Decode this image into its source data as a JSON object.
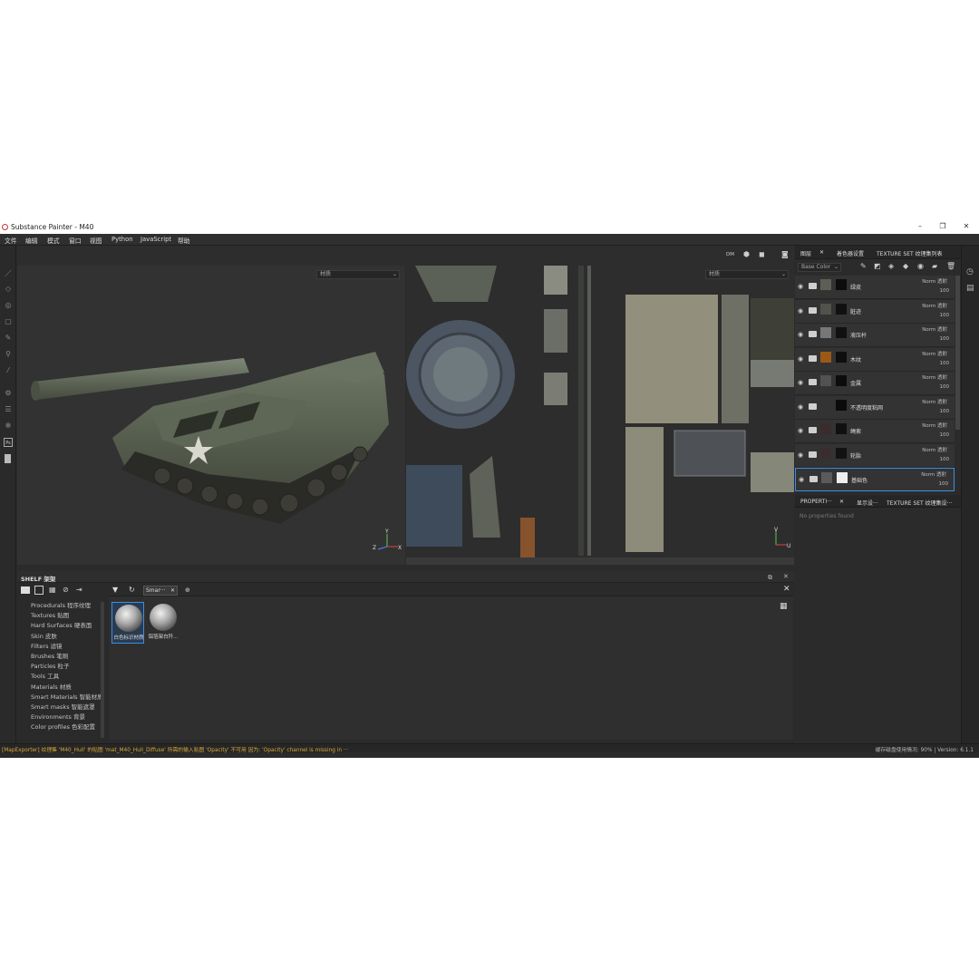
{
  "window": {
    "title": "Substance Painter - M40",
    "min": "–",
    "max": "❐",
    "close": "✕"
  },
  "menu": [
    "文件",
    "编辑",
    "模式",
    "窗口",
    "视图",
    "Python",
    "JavaScript",
    "帮助"
  ],
  "viewport": {
    "material_dropdown_3d": "材质",
    "material_dropdown_2d": "材质",
    "axis_3d": {
      "y": "Y",
      "z": "Z",
      "x": "X"
    },
    "axis_2d": {
      "v": "V",
      "u": "U"
    },
    "icons": [
      "dm-icon",
      "cube-icon",
      "camera-icon",
      "screenshot-icon"
    ],
    "dm_label": "DM"
  },
  "shelf": {
    "title": "SHELF 架架",
    "categories": [
      "Procedurals 程序纹理",
      "Textures 贴图",
      "Hard Surfaces 硬表面",
      "Skin 皮肤",
      "Filters 滤镜",
      "Brushes 笔刷",
      "Particles 粒子",
      "Tools 工具",
      "Materials 材质",
      "Smart Materials 智能材质",
      "Smart masks 智能遮罩",
      "Environments 背景",
      "Color profiles 色彩配置"
    ],
    "tab_label": "Smar···",
    "tab_close": "✕",
    "tab_add": "⊕",
    "items": [
      {
        "label": "白色标识材质"
      },
      {
        "label": "铝箔架白歼..."
      }
    ]
  },
  "layers": {
    "tabs": [
      "图层",
      "✕",
      "着色器设置",
      "TEXTURE SET 纹理集列表"
    ],
    "channel": "Base Color",
    "list": [
      {
        "name": "绿皮",
        "blend": "Norm 透射",
        "opacity": "100",
        "sw1": "#5c5f56",
        "sw2": "#0d0d0d"
      },
      {
        "name": "脏迹",
        "blend": "Norm 透射",
        "opacity": "100",
        "sw1": "#4f534b",
        "sw2": "#111"
      },
      {
        "name": "液压杆",
        "blend": "Norm 透射",
        "opacity": "100",
        "sw1": "#777",
        "sw2": "#111"
      },
      {
        "name": "木纹",
        "blend": "Norm 透射",
        "opacity": "100",
        "sw1": "#9a5a16",
        "sw2": "#0e0e0e"
      },
      {
        "name": "金属",
        "blend": "Norm 透射",
        "opacity": "100",
        "sw1": "#525252",
        "sw2": "#0c0c0c"
      },
      {
        "name": "不透明度粘网",
        "blend": "Norm 透射",
        "opacity": "100",
        "sw1": "#333",
        "sw2": "#0b0b0b"
      },
      {
        "name": "绳索",
        "blend": "Norm 透射",
        "opacity": "100",
        "sw1": "#3a2c2a",
        "sw2": "#101010"
      },
      {
        "name": "轮胎",
        "blend": "Norm 透射",
        "opacity": "100",
        "sw1": "#3b2d2f",
        "sw2": "#121212"
      },
      {
        "name": "基础色",
        "blend": "Norm 透射",
        "opacity": "100",
        "sw1": "#5a5a5a",
        "sw2": "#eeeeee"
      }
    ]
  },
  "properties": {
    "tabs": [
      "PROPERTI···",
      "✕",
      "显示设···",
      "TEXTURE SET 纹理集设···"
    ],
    "empty": "No properties found"
  },
  "status": {
    "error": "[MapExporter] 纹理集 'M40_Hull' 的贴图 'mat_M40_Hull_Diffuse' 所需的输入贴图 'Opacity' 不可用 因为: 'Opacity' channel is missing in ···",
    "cache": "缓存磁盘使用情况: 90% | Version: 6.1.1"
  },
  "colors": {
    "accent": "#3a8ee6"
  }
}
